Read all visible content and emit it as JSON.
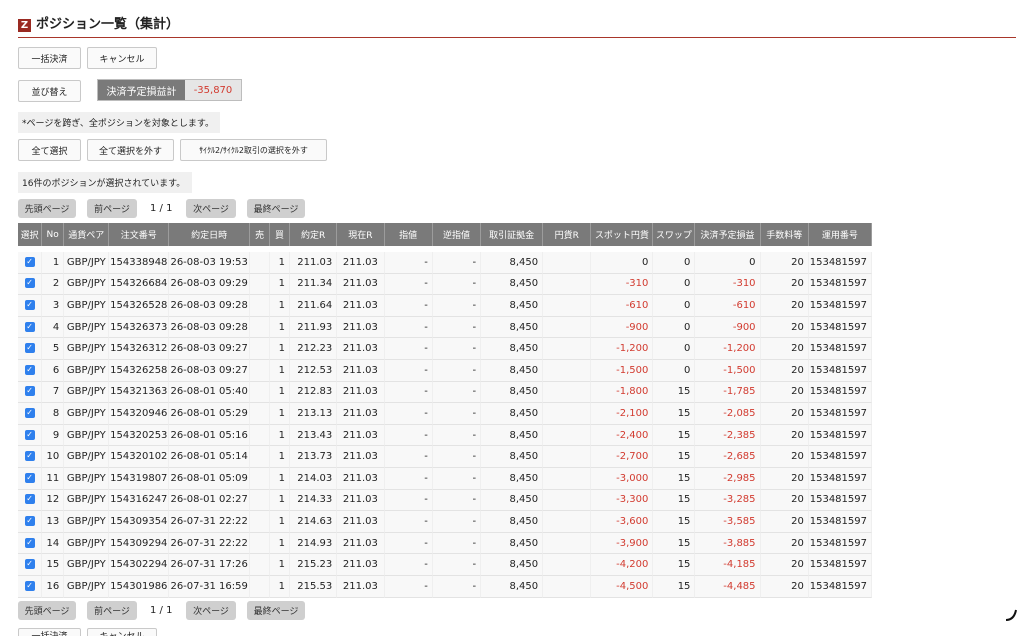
{
  "header": {
    "logo": "Z",
    "title": "ポジション一覧（集計）"
  },
  "toolbar": {
    "bulk_settle": "一括決済",
    "cancel": "キャンセル",
    "sort": "並び替え"
  },
  "pl": {
    "label": "決済予定損益計",
    "value": "-35,870"
  },
  "notice": "*ページを跨ぎ、全ポジションを対象とします。",
  "selection": {
    "select_all": "全て選択",
    "deselect_all": "全て選択を外す",
    "deselect_cycle": "ｻｲｸﾙ2/ｻｲｸﾙ2取引の選択を外す",
    "count_text": "16件のポジションが選択されています。"
  },
  "pager": {
    "first": "先頭ページ",
    "prev": "前ページ",
    "page": "1 / 1",
    "next": "次ページ",
    "last": "最終ページ"
  },
  "table": {
    "headers": [
      "選択",
      "No",
      "通貨ペア",
      "注文番号",
      "約定日時",
      "売",
      "買",
      "約定R",
      "現在R",
      "指値",
      "逆指値",
      "取引証拠金",
      "円貨R",
      "スポット円貨",
      "スワップ",
      "決済予定損益",
      "手数料等",
      "運用番号"
    ],
    "rows": [
      {
        "no": "1",
        "pair": "GBP/JPY",
        "order": "154338948",
        "date": "26-08-03 19:53",
        "sell": "",
        "buy": "1",
        "rate": "211.03",
        "cur": "211.03",
        "limit": "-",
        "stop": "-",
        "margin": "8,450",
        "jpy": "",
        "spot": "0",
        "swap": "0",
        "pl": "0",
        "fee": "20",
        "op": "153481597"
      },
      {
        "no": "2",
        "pair": "GBP/JPY",
        "order": "154326684",
        "date": "26-08-03 09:29",
        "sell": "",
        "buy": "1",
        "rate": "211.34",
        "cur": "211.03",
        "limit": "-",
        "stop": "-",
        "margin": "8,450",
        "jpy": "",
        "spot": "-310",
        "swap": "0",
        "pl": "-310",
        "fee": "20",
        "op": "153481597"
      },
      {
        "no": "3",
        "pair": "GBP/JPY",
        "order": "154326528",
        "date": "26-08-03 09:28",
        "sell": "",
        "buy": "1",
        "rate": "211.64",
        "cur": "211.03",
        "limit": "-",
        "stop": "-",
        "margin": "8,450",
        "jpy": "",
        "spot": "-610",
        "swap": "0",
        "pl": "-610",
        "fee": "20",
        "op": "153481597"
      },
      {
        "no": "4",
        "pair": "GBP/JPY",
        "order": "154326373",
        "date": "26-08-03 09:28",
        "sell": "",
        "buy": "1",
        "rate": "211.93",
        "cur": "211.03",
        "limit": "-",
        "stop": "-",
        "margin": "8,450",
        "jpy": "",
        "spot": "-900",
        "swap": "0",
        "pl": "-900",
        "fee": "20",
        "op": "153481597"
      },
      {
        "no": "5",
        "pair": "GBP/JPY",
        "order": "154326312",
        "date": "26-08-03 09:27",
        "sell": "",
        "buy": "1",
        "rate": "212.23",
        "cur": "211.03",
        "limit": "-",
        "stop": "-",
        "margin": "8,450",
        "jpy": "",
        "spot": "-1,200",
        "swap": "0",
        "pl": "-1,200",
        "fee": "20",
        "op": "153481597"
      },
      {
        "no": "6",
        "pair": "GBP/JPY",
        "order": "154326258",
        "date": "26-08-03 09:27",
        "sell": "",
        "buy": "1",
        "rate": "212.53",
        "cur": "211.03",
        "limit": "-",
        "stop": "-",
        "margin": "8,450",
        "jpy": "",
        "spot": "-1,500",
        "swap": "0",
        "pl": "-1,500",
        "fee": "20",
        "op": "153481597"
      },
      {
        "no": "7",
        "pair": "GBP/JPY",
        "order": "154321363",
        "date": "26-08-01 05:40",
        "sell": "",
        "buy": "1",
        "rate": "212.83",
        "cur": "211.03",
        "limit": "-",
        "stop": "-",
        "margin": "8,450",
        "jpy": "",
        "spot": "-1,800",
        "swap": "15",
        "pl": "-1,785",
        "fee": "20",
        "op": "153481597"
      },
      {
        "no": "8",
        "pair": "GBP/JPY",
        "order": "154320946",
        "date": "26-08-01 05:29",
        "sell": "",
        "buy": "1",
        "rate": "213.13",
        "cur": "211.03",
        "limit": "-",
        "stop": "-",
        "margin": "8,450",
        "jpy": "",
        "spot": "-2,100",
        "swap": "15",
        "pl": "-2,085",
        "fee": "20",
        "op": "153481597"
      },
      {
        "no": "9",
        "pair": "GBP/JPY",
        "order": "154320253",
        "date": "26-08-01 05:16",
        "sell": "",
        "buy": "1",
        "rate": "213.43",
        "cur": "211.03",
        "limit": "-",
        "stop": "-",
        "margin": "8,450",
        "jpy": "",
        "spot": "-2,400",
        "swap": "15",
        "pl": "-2,385",
        "fee": "20",
        "op": "153481597"
      },
      {
        "no": "10",
        "pair": "GBP/JPY",
        "order": "154320102",
        "date": "26-08-01 05:14",
        "sell": "",
        "buy": "1",
        "rate": "213.73",
        "cur": "211.03",
        "limit": "-",
        "stop": "-",
        "margin": "8,450",
        "jpy": "",
        "spot": "-2,700",
        "swap": "15",
        "pl": "-2,685",
        "fee": "20",
        "op": "153481597"
      },
      {
        "no": "11",
        "pair": "GBP/JPY",
        "order": "154319807",
        "date": "26-08-01 05:09",
        "sell": "",
        "buy": "1",
        "rate": "214.03",
        "cur": "211.03",
        "limit": "-",
        "stop": "-",
        "margin": "8,450",
        "jpy": "",
        "spot": "-3,000",
        "swap": "15",
        "pl": "-2,985",
        "fee": "20",
        "op": "153481597"
      },
      {
        "no": "12",
        "pair": "GBP/JPY",
        "order": "154316247",
        "date": "26-08-01 02:27",
        "sell": "",
        "buy": "1",
        "rate": "214.33",
        "cur": "211.03",
        "limit": "-",
        "stop": "-",
        "margin": "8,450",
        "jpy": "",
        "spot": "-3,300",
        "swap": "15",
        "pl": "-3,285",
        "fee": "20",
        "op": "153481597"
      },
      {
        "no": "13",
        "pair": "GBP/JPY",
        "order": "154309354",
        "date": "26-07-31 22:22",
        "sell": "",
        "buy": "1",
        "rate": "214.63",
        "cur": "211.03",
        "limit": "-",
        "stop": "-",
        "margin": "8,450",
        "jpy": "",
        "spot": "-3,600",
        "swap": "15",
        "pl": "-3,585",
        "fee": "20",
        "op": "153481597"
      },
      {
        "no": "14",
        "pair": "GBP/JPY",
        "order": "154309294",
        "date": "26-07-31 22:22",
        "sell": "",
        "buy": "1",
        "rate": "214.93",
        "cur": "211.03",
        "limit": "-",
        "stop": "-",
        "margin": "8,450",
        "jpy": "",
        "spot": "-3,900",
        "swap": "15",
        "pl": "-3,885",
        "fee": "20",
        "op": "153481597"
      },
      {
        "no": "15",
        "pair": "GBP/JPY",
        "order": "154302294",
        "date": "26-07-31 17:26",
        "sell": "",
        "buy": "1",
        "rate": "215.23",
        "cur": "211.03",
        "limit": "-",
        "stop": "-",
        "margin": "8,450",
        "jpy": "",
        "spot": "-4,200",
        "swap": "15",
        "pl": "-4,185",
        "fee": "20",
        "op": "153481597"
      },
      {
        "no": "16",
        "pair": "GBP/JPY",
        "order": "154301986",
        "date": "26-07-31 16:59",
        "sell": "",
        "buy": "1",
        "rate": "215.53",
        "cur": "211.03",
        "limit": "-",
        "stop": "-",
        "margin": "8,450",
        "jpy": "",
        "spot": "-4,500",
        "swap": "15",
        "pl": "-4,485",
        "fee": "20",
        "op": "153481597"
      }
    ]
  },
  "colors": {
    "accent": "#a8362a",
    "negative": "#d23b30",
    "header_bg": "#7a7a7a",
    "checkbox": "#2f80ed"
  }
}
